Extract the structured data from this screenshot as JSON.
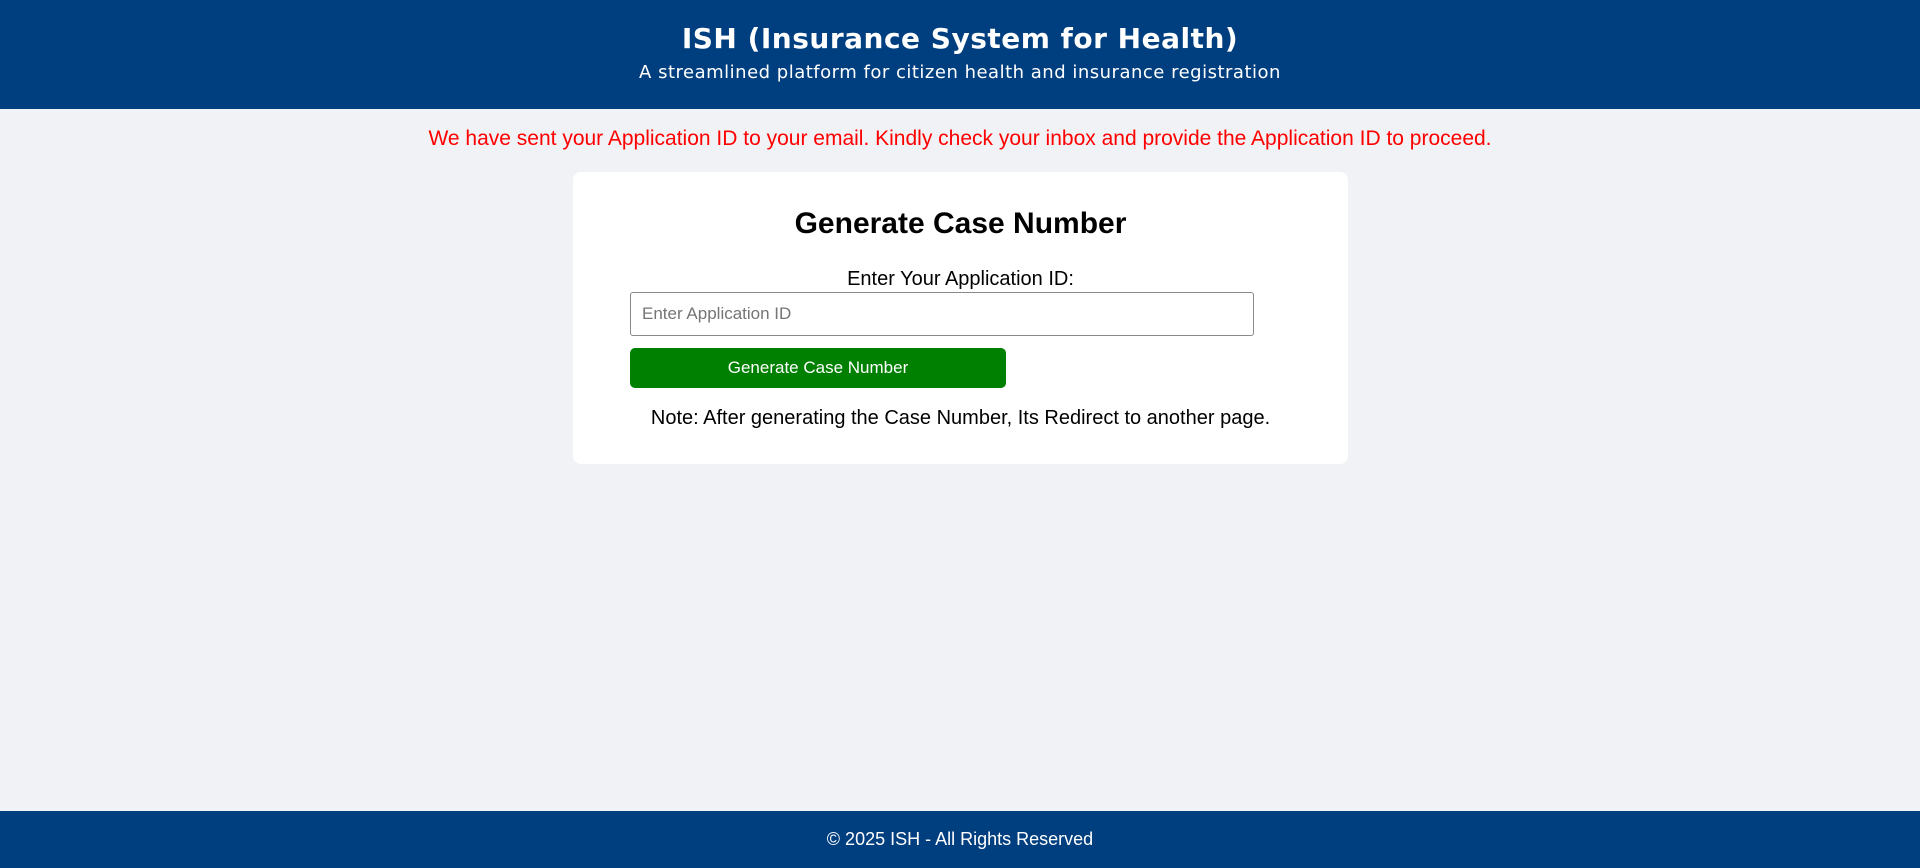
{
  "header": {
    "title": "ISH (Insurance System for Health)",
    "subtitle": "A streamlined platform for citizen health and insurance registration"
  },
  "message": "We have sent your Application ID to your email. Kindly check your inbox and provide the Application ID to proceed.",
  "card": {
    "heading": "Generate Case Number",
    "label": "Enter Your Application ID:",
    "input_value": "",
    "input_placeholder": "Enter Application ID",
    "button_label": "Generate Case Number",
    "note": "Note: After generating the Case Number, Its Redirect to another page."
  },
  "footer": {
    "copyright": "© 2025 ISH - All Rights Reserved"
  },
  "colors": {
    "header_bg": "#003f7f",
    "page_bg": "#f0f2f5",
    "message": "#ff0000",
    "button_bg": "#008000"
  }
}
